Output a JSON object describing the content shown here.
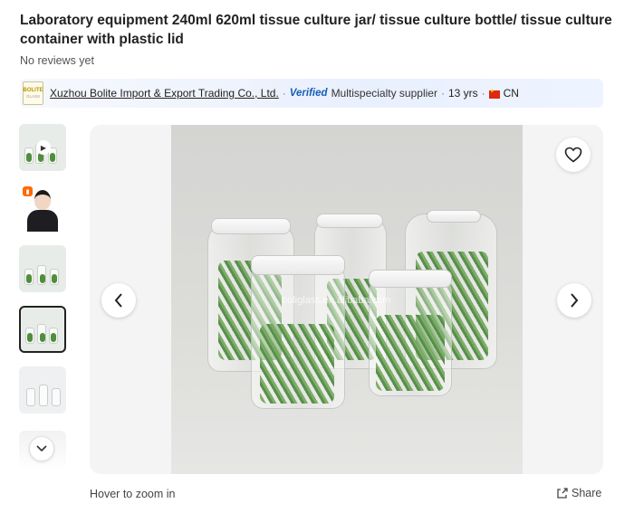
{
  "product": {
    "title": "Laboratory equipment 240ml 620ml tissue culture jar/ tissue culture bottle/ tissue culture container with plastic lid",
    "reviews": "No reviews yet"
  },
  "supplier": {
    "logo_text": "BOLITE",
    "logo_subtext": "GLASS",
    "name": "Xuzhou Bolite Import & Export Trading Co., Ltd.",
    "separator": "·",
    "verified_label": "Verified",
    "type": "Multispecialty supplier",
    "years": "13 yrs",
    "country": "CN"
  },
  "gallery": {
    "thumbnails": [
      {
        "icon": "play-icon",
        "kind": "video"
      },
      {
        "icon": "person",
        "kind": "image"
      },
      {
        "kind": "image"
      },
      {
        "kind": "image",
        "active": true
      },
      {
        "kind": "image"
      }
    ],
    "watermark": "boliglass.en.alibaba.com",
    "prev_icon": "chevron-left-icon",
    "next_icon": "chevron-right-icon",
    "favorite_icon": "heart-icon",
    "more_icon": "chevron-down-icon",
    "hover_hint": "Hover to zoom in",
    "share_label": "Share"
  },
  "colors": {
    "verified": "#1a5cb7",
    "flag": "#de2910"
  }
}
